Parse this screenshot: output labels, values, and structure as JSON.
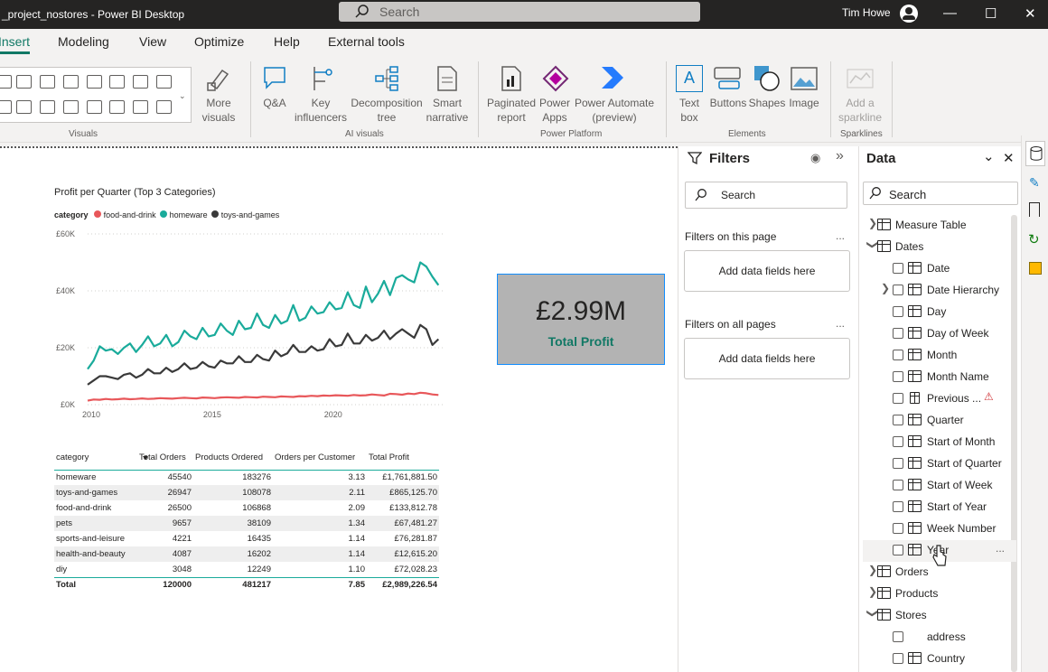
{
  "window": {
    "title": "_project_nostores - Power BI Desktop",
    "search": "Search",
    "user": "Tim Howe",
    "minimize": "—",
    "maximize": "☐",
    "close": "✕"
  },
  "menu": {
    "items": [
      "Insert",
      "Modeling",
      "View",
      "Optimize",
      "Help",
      "External tools"
    ]
  },
  "ribbon": {
    "more_visuals": "More visuals",
    "buttons": {
      "qa": "Q&A",
      "key_influencers": "Key influencers",
      "decomposition_tree": "Decomposition tree",
      "smart_narrative": "Smart narrative",
      "paginated_report": "Paginated report",
      "power_apps": "Power Apps",
      "power_automate": "Power Automate (preview)",
      "text_box": "Text box",
      "buttons": "Buttons",
      "shapes": "Shapes",
      "image": "Image",
      "add_sparkline": "Add a sparkline"
    },
    "groups": {
      "visuals": "Visuals",
      "ai_visuals": "AI visuals",
      "power_platform": "Power Platform",
      "elements": "Elements",
      "sparklines": "Sparklines"
    }
  },
  "chart_data": {
    "type": "line",
    "title": "Profit per Quarter (Top 3 Categories)",
    "legend_title": "category",
    "legend_placement": "top-left",
    "grid": true,
    "y_tick_labels": [
      "£60K",
      "£40K",
      "£20K",
      "£0K"
    ],
    "x_tick_labels": [
      "2010",
      "2015",
      "2020"
    ],
    "ylim": [
      0,
      60000
    ],
    "xlim": [
      2010,
      2024.75
    ],
    "series": [
      {
        "name": "food-and-drink",
        "color": "#e8575a",
        "x_start": 2010,
        "step": 0.25,
        "values": [
          1400,
          1800,
          1700,
          2000,
          1800,
          1900,
          2100,
          1900,
          2000,
          2200,
          2000,
          2100,
          2300,
          2200,
          2100,
          2300,
          2400,
          2300,
          2200,
          2500,
          2400,
          2300,
          2500,
          2600,
          2500,
          2400,
          2700,
          2600,
          2500,
          2800,
          2700,
          2600,
          2900,
          2800,
          2700,
          3000,
          2900,
          3100,
          3000,
          3200,
          3100,
          3300,
          3200,
          3100,
          3400,
          3200,
          3300,
          3600,
          3400,
          3200,
          3800,
          3700,
          3500,
          3900,
          3700,
          4200,
          4000,
          3600,
          3400
        ]
      },
      {
        "name": "homeware",
        "color": "#1aab9b",
        "x_start": 2010,
        "step": 0.25,
        "values": [
          12500,
          15500,
          20500,
          19000,
          19500,
          17800,
          20000,
          21500,
          18500,
          21000,
          24000,
          20500,
          21500,
          24500,
          20500,
          22000,
          26000,
          24000,
          23000,
          27000,
          24000,
          24500,
          28500,
          26000,
          24500,
          29500,
          26500,
          27000,
          32000,
          28000,
          27000,
          31500,
          28500,
          29500,
          35000,
          29500,
          30500,
          34500,
          32000,
          32500,
          36000,
          33500,
          34000,
          39500,
          35000,
          34000,
          41500,
          36000,
          39000,
          43500,
          38500,
          44500,
          45500,
          44000,
          43000,
          50000,
          48500,
          45000,
          42000
        ]
      },
      {
        "name": "toys-and-games",
        "color": "#3a3a3a",
        "x_start": 2010,
        "step": 0.25,
        "values": [
          7000,
          8500,
          10000,
          10000,
          9500,
          9000,
          10500,
          11000,
          9500,
          10500,
          12500,
          11000,
          11000,
          13000,
          11500,
          12500,
          14500,
          12500,
          13000,
          15000,
          13500,
          13000,
          15500,
          14500,
          14500,
          17000,
          15000,
          15000,
          17500,
          16000,
          15500,
          19000,
          17000,
          18000,
          21000,
          18500,
          18500,
          20500,
          19000,
          19500,
          23000,
          20500,
          21000,
          25000,
          21500,
          21500,
          24500,
          22500,
          23500,
          26000,
          23000,
          25000,
          26500,
          25000,
          23500,
          28000,
          26500,
          21000,
          23000
        ]
      }
    ]
  },
  "card": {
    "value": "£2.99M",
    "label": "Total Profit"
  },
  "table": {
    "headers": [
      "category",
      "Total Orders",
      "Products Ordered",
      "Orders per Customer",
      "Total Profit"
    ],
    "rows": [
      [
        "homeware",
        "45540",
        "183276",
        "3.13",
        "£1,761,881.50"
      ],
      [
        "toys-and-games",
        "26947",
        "108078",
        "2.11",
        "£865,125.70"
      ],
      [
        "food-and-drink",
        "26500",
        "106868",
        "2.09",
        "£133,812.78"
      ],
      [
        "pets",
        "9657",
        "38109",
        "1.34",
        "£67,481.27"
      ],
      [
        "sports-and-leisure",
        "4221",
        "16435",
        "1.14",
        "£76,281.87"
      ],
      [
        "health-and-beauty",
        "4087",
        "16202",
        "1.14",
        "£12,615.20"
      ],
      [
        "diy",
        "3048",
        "12249",
        "1.10",
        "£72,028.23"
      ]
    ],
    "total": [
      "Total",
      "120000",
      "481217",
      "7.85",
      "£2,989,226.54"
    ]
  },
  "filters": {
    "title": "Filters",
    "search": "Search",
    "on_page": "Filters on this page",
    "on_all_pages": "Filters on all pages",
    "add_fields": "Add data fields here",
    "more": "..."
  },
  "data_pane": {
    "title": "Data",
    "search": "Search",
    "tables": [
      {
        "label": "Measure Table"
      },
      {
        "label": "Dates"
      }
    ],
    "date_fields": [
      "Date",
      "Date Hierarchy",
      "Day",
      "Day of Week",
      "Month",
      "Month Name",
      "Previous ...",
      "Quarter",
      "Start of Month",
      "Start of Quarter",
      "Start of Week",
      "Start of Year",
      "Week Number",
      "Year"
    ],
    "other_tables": [
      "Orders",
      "Products",
      "Stores"
    ],
    "store_fields": [
      "address",
      "Country"
    ]
  }
}
